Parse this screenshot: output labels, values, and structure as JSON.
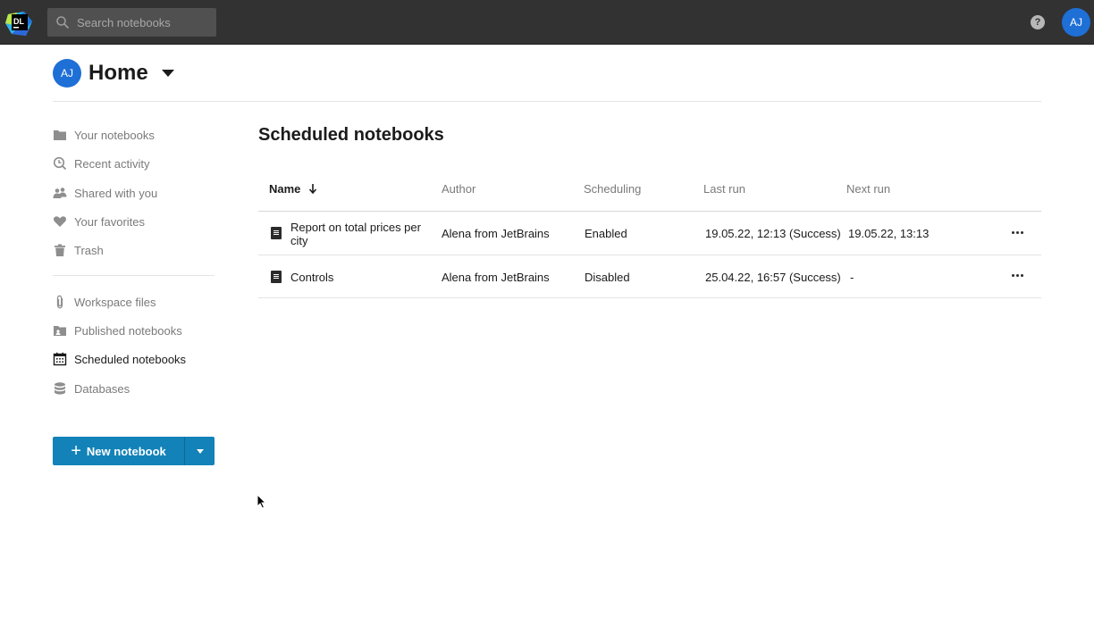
{
  "app": {
    "logo_text": "DL",
    "search_placeholder": "Search notebooks",
    "help_label": "?",
    "user_initials": "AJ"
  },
  "header": {
    "avatar_initials": "AJ",
    "title": "Home"
  },
  "sidebar": {
    "items": [
      {
        "label": "Your notebooks",
        "icon": "folder-icon"
      },
      {
        "label": "Recent activity",
        "icon": "clock-icon"
      },
      {
        "label": "Shared with you",
        "icon": "people-icon"
      },
      {
        "label": "Your favorites",
        "icon": "heart-icon"
      },
      {
        "label": "Trash",
        "icon": "trash-icon"
      },
      {
        "label": "Workspace files",
        "icon": "paperclip-icon"
      },
      {
        "label": "Published notebooks",
        "icon": "published-folder-icon"
      },
      {
        "label": "Scheduled notebooks",
        "icon": "calendar-icon",
        "active": true
      },
      {
        "label": "Databases",
        "icon": "database-icon"
      }
    ],
    "new_notebook_label": "New notebook"
  },
  "main": {
    "title": "Scheduled notebooks",
    "columns": {
      "name": "Name",
      "author": "Author",
      "scheduling": "Scheduling",
      "last_run": "Last run",
      "next_run": "Next run"
    },
    "sort": {
      "column": "name",
      "direction": "descending-arrow"
    },
    "rows": [
      {
        "name_line1": "Report on total prices per",
        "name_line2": "city",
        "author": "Alena from JetBrains",
        "scheduling": "Enabled",
        "last_run": "19.05.22, 12:13 (Success)",
        "next_run": "19.05.22, 13:13"
      },
      {
        "name_line1": "Controls",
        "name_line2": "",
        "author": "Alena from JetBrains",
        "scheduling": "Disabled",
        "last_run": "25.04.22, 16:57 (Success)",
        "next_run": "-"
      }
    ]
  },
  "colors": {
    "topbar": "#323232",
    "accent": "#1282b8",
    "avatar": "#1e6fd6"
  }
}
